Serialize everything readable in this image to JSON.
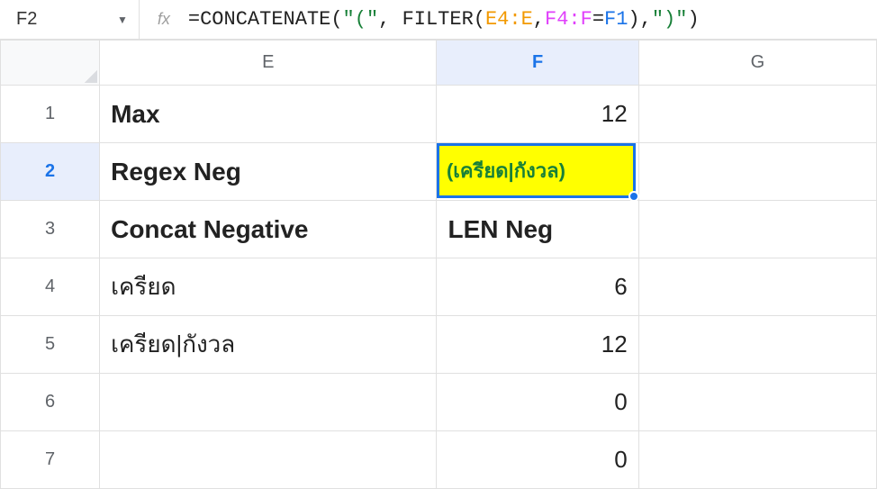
{
  "formula_bar": {
    "cell_ref": "F2",
    "fx_label": "fx",
    "formula_tokens": [
      {
        "t": "=",
        "c": "tok-func"
      },
      {
        "t": "CONCATENATE",
        "c": "tok-func"
      },
      {
        "t": "(",
        "c": "tok-paren"
      },
      {
        "t": "\"(\"",
        "c": "tok-str"
      },
      {
        "t": ", ",
        "c": "tok-func"
      },
      {
        "t": "FILTER",
        "c": "tok-func"
      },
      {
        "t": "(",
        "c": "tok-paren"
      },
      {
        "t": "E4:E",
        "c": "tok-r1"
      },
      {
        "t": ",",
        "c": "tok-func"
      },
      {
        "t": "F4:F",
        "c": "tok-r2"
      },
      {
        "t": "=",
        "c": "tok-func"
      },
      {
        "t": "F1",
        "c": "tok-r3"
      },
      {
        "t": ")",
        "c": "tok-paren"
      },
      {
        "t": ",",
        "c": "tok-func"
      },
      {
        "t": "\")\"",
        "c": "tok-str"
      },
      {
        "t": ")",
        "c": "tok-paren"
      }
    ]
  },
  "columns": [
    "E",
    "F",
    "G"
  ],
  "selected_col": "F",
  "rows": [
    "1",
    "2",
    "3",
    "4",
    "5",
    "6",
    "7"
  ],
  "selected_row": "2",
  "cells": {
    "E1": {
      "v": "Max",
      "bold": true
    },
    "F1": {
      "v": "12",
      "num": true
    },
    "E2": {
      "v": "Regex Neg",
      "bold": true
    },
    "F2": {
      "v": "(เครียด|กังวล)",
      "active": true
    },
    "E3": {
      "v": "Concat Negative",
      "bold": true
    },
    "F3": {
      "v": "LEN Neg",
      "bold": true
    },
    "E4": {
      "v": "เครียด"
    },
    "F4": {
      "v": "6",
      "num": true
    },
    "E5": {
      "v": "เครียด|กังวล"
    },
    "F5": {
      "v": "12",
      "num": true
    },
    "F6": {
      "v": "0",
      "num": true
    },
    "F7": {
      "v": "0",
      "num": true
    }
  }
}
